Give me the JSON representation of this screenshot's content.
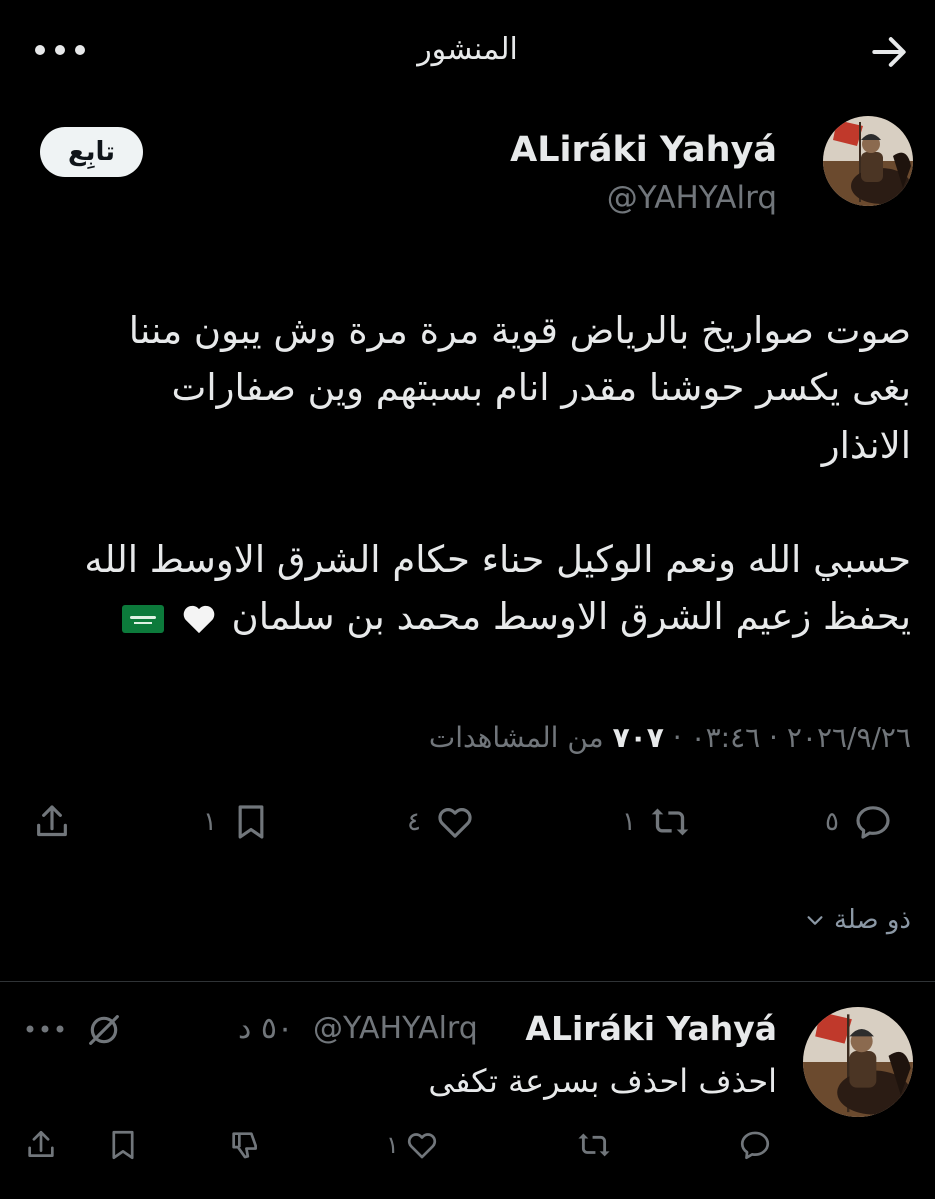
{
  "header": {
    "title": "المنشور",
    "back_icon": "arrow-right-icon",
    "more_icon": "more-icon"
  },
  "tweet": {
    "author_name": "ALiráki Yahyá",
    "author_handle": "@YAHYAlrq",
    "follow_label": "تابِع",
    "text_lines": [
      "صوت صواريخ بالرياض قوية مرة مرة وش يبون مننا",
      "بغى يكسر حوشنا مقدر انام بسبتهم وين صفارات",
      "الانذار",
      "",
      "حسبي الله ونعم الوكيل حناء حكام الشرق الاوسط الله",
      "يحفظ زعيم الشرق الاوسط محمد بن سلمان"
    ],
    "emojis": [
      "white-heart",
      "saudi-flag"
    ],
    "meta": {
      "datetime": "٢٠٢٦/٩/٢٦ · ٠٣:٤٦ ·",
      "views_count": "٧٠٧",
      "views_label": "من المشاهدات"
    },
    "actions": {
      "replies": "٥",
      "retweets": "١",
      "likes": "٤",
      "bookmarks": "١"
    },
    "replies_toggle": "ذو صلة"
  },
  "reply": {
    "author_name": "ALiráki Yahyá",
    "author_handle": "@YAHYAlrq",
    "time": "٥٠ د",
    "text": "احذف احذف بسرعة تكفى",
    "actions": {
      "likes": "١"
    }
  },
  "colors": {
    "background": "#000000",
    "text": "#e7e9ea",
    "secondary": "#71767b",
    "divider": "#2f3336"
  }
}
